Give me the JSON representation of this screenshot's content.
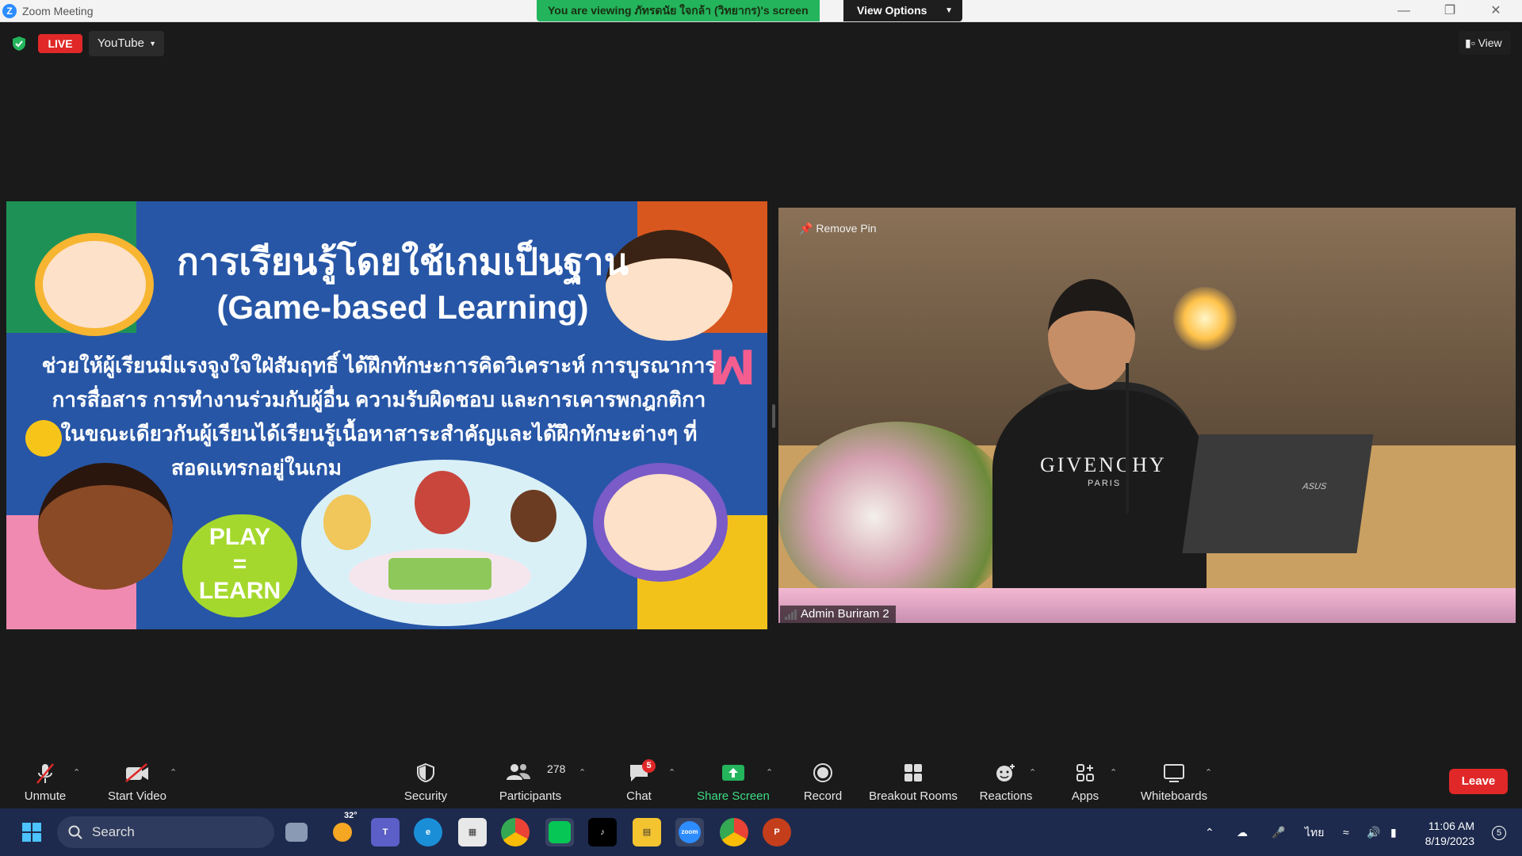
{
  "window": {
    "title": "Zoom Meeting",
    "viewing_banner": "You are viewing ภัทรดนัย ใจกล้า (วิทยากร)'s screen",
    "view_options_label": "View Options"
  },
  "top_controls": {
    "live_label": "LIVE",
    "stream_target": "YouTube",
    "view_label": "View"
  },
  "slide": {
    "title": "การเรียนรู้โดยใช้เกมเป็นฐาน",
    "subtitle": "(Game-based Learning)",
    "body_lines": [
      "ช่วยให้ผู้เรียนมีแรงจูงใจใฝ่สัมฤทธิ์ ได้ฝึกทักษะการคิดวิเคราะห์ การบูรณาการ",
      "การสื่อสาร การทำงานร่วมกับผู้อื่น ความรับผิดชอบ และการเคารพกฎกติกา",
      "ในขณะเดียวกันผู้เรียนได้เรียนรู้เนื้อหาสาระสำคัญและได้ฝึกทักษะต่างๆ ที่",
      "สอดแทรกอยู่ในเกม"
    ],
    "play_learn": [
      "PLAY",
      "=",
      "LEARN"
    ]
  },
  "video": {
    "remove_pin_label": "Remove Pin",
    "participant_name": "Admin Buriram 2",
    "shirt_text": "GIVENCHY",
    "shirt_subtext": "PARIS",
    "laptop_brand": "ASUS"
  },
  "toolbar": {
    "unmute": "Unmute",
    "start_video": "Start Video",
    "security": "Security",
    "participants": "Participants",
    "participants_count": "278",
    "chat": "Chat",
    "chat_badge": "5",
    "share_screen": "Share Screen",
    "record": "Record",
    "breakout_rooms": "Breakout Rooms",
    "reactions": "Reactions",
    "apps": "Apps",
    "whiteboards": "Whiteboards",
    "leave": "Leave"
  },
  "taskbar": {
    "search_placeholder": "Search",
    "weather_temp": "32°",
    "language": "ไทย",
    "time": "11:06 AM",
    "date": "8/19/2023",
    "notification_count": "5"
  },
  "colors": {
    "accent_green": "#23b45c",
    "danger_red": "#e02828",
    "zoom_blue": "#2d8cff"
  }
}
